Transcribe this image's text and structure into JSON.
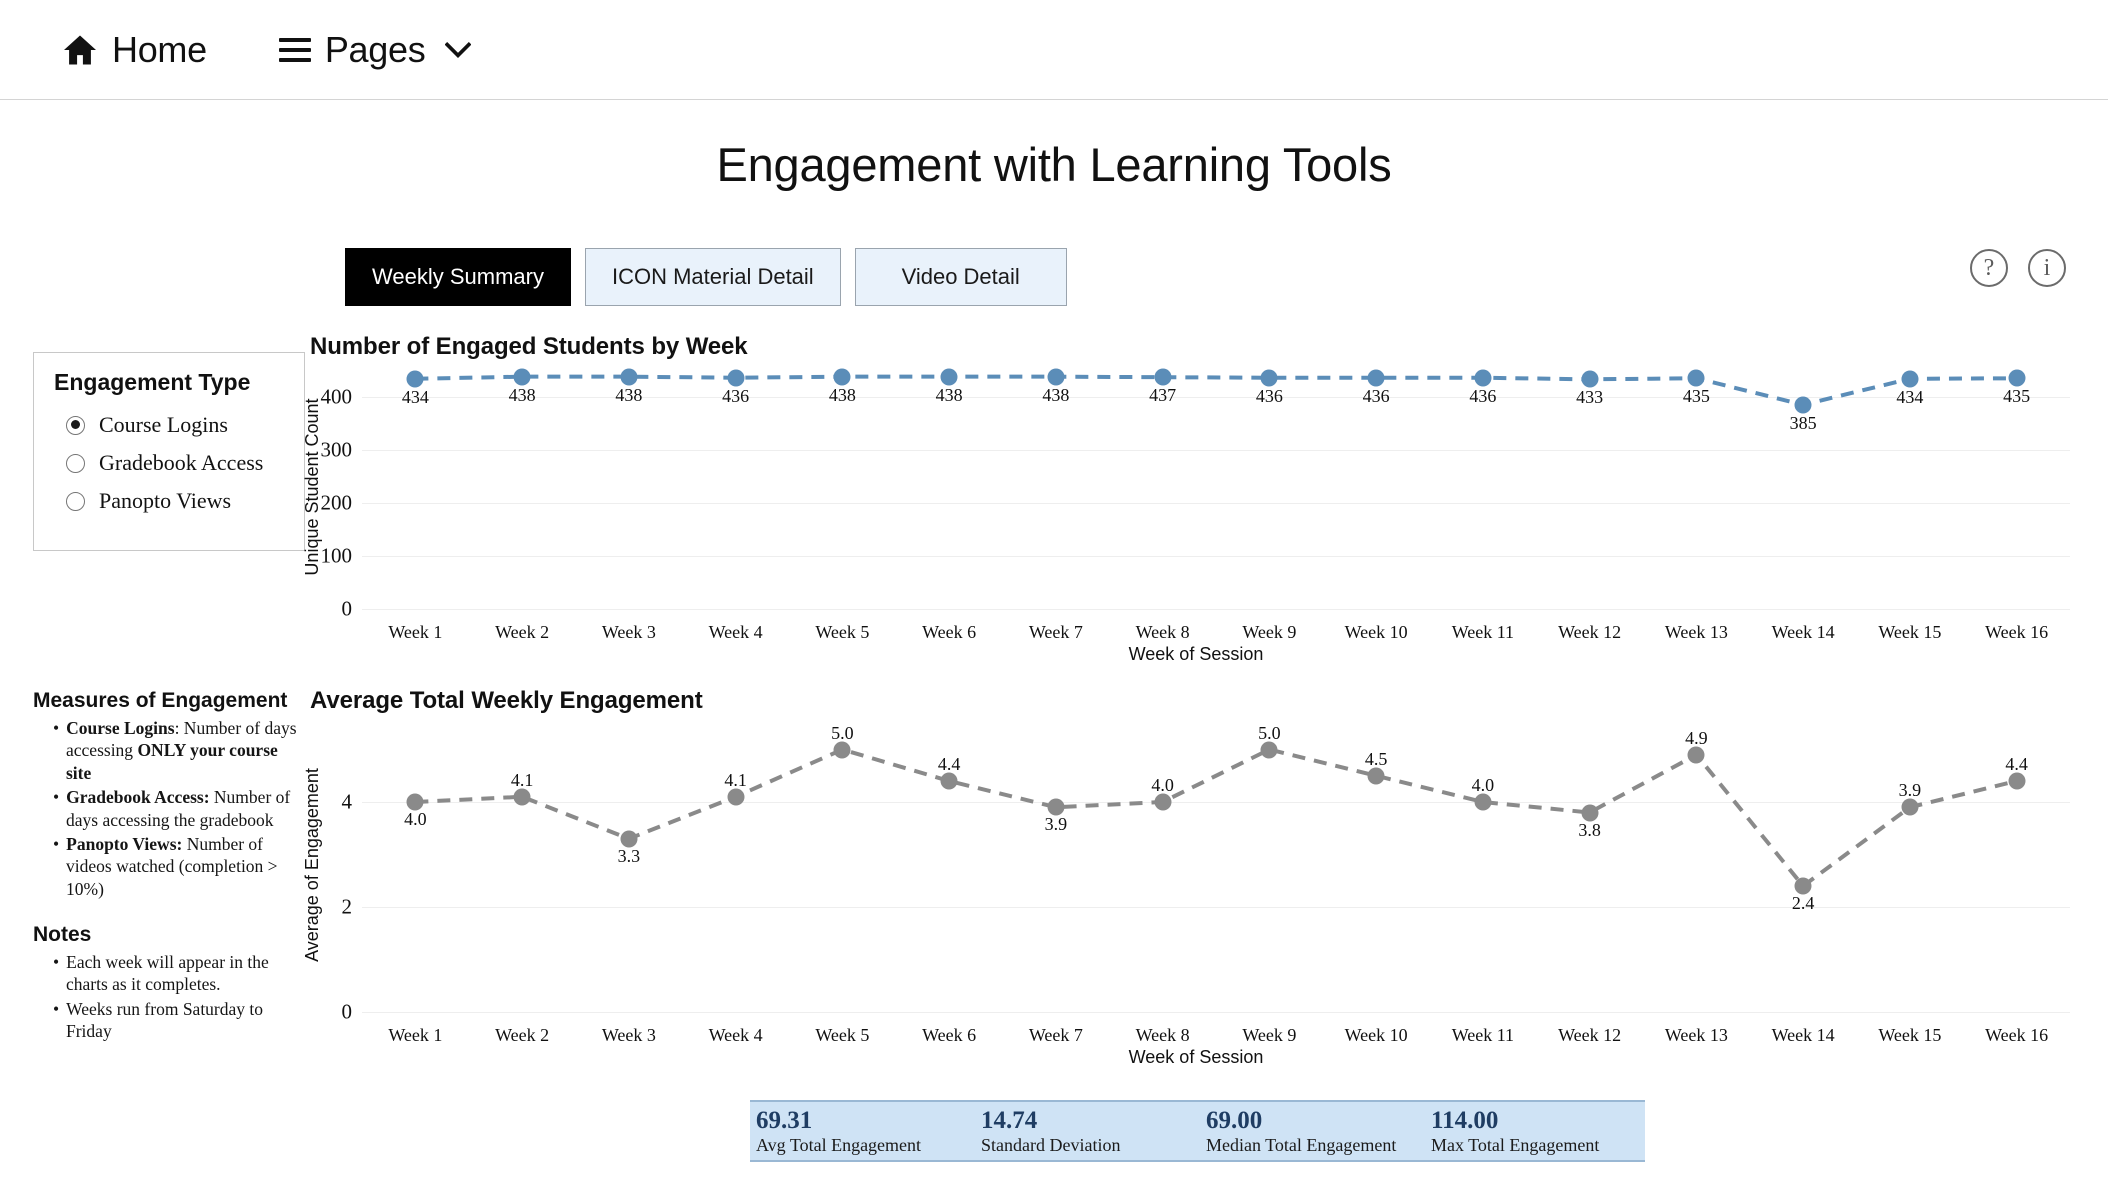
{
  "nav": {
    "home_label": "Home",
    "pages_label": "Pages",
    "home_icon": "home-icon",
    "menu_icon": "hamburger-icon",
    "chevron_icon": "chevron-down-icon"
  },
  "page_title": "Engagement with Learning Tools",
  "tabs": [
    {
      "label": "Weekly Summary",
      "active": true
    },
    {
      "label": "ICON Material Detail",
      "active": false
    },
    {
      "label": "Video Detail",
      "active": false
    }
  ],
  "top_icons": [
    {
      "name": "help-icon",
      "glyph": "?"
    },
    {
      "name": "info-icon",
      "glyph": "i"
    }
  ],
  "engagement_type": {
    "title": "Engagement Type",
    "options": [
      {
        "label": "Course Logins",
        "selected": true
      },
      {
        "label": "Gradebook Access",
        "selected": false
      },
      {
        "label": "Panopto Views",
        "selected": false
      }
    ]
  },
  "measures": {
    "title": "Measures of Engagement",
    "items": [
      {
        "term": "Course Logins",
        "sep": ": ",
        "text": "Number of days accessing ",
        "strong_tail": "ONLY your course site"
      },
      {
        "term": "Gradebook Access:",
        "sep": " ",
        "text": "Number of days accessing the gradebook",
        "strong_tail": ""
      },
      {
        "term": "Panopto Views:",
        "sep": " ",
        "text": "Number of videos watched (completion > 10%)",
        "strong_tail": ""
      }
    ]
  },
  "notes": {
    "title": "Notes",
    "items": [
      "Each week will appear in the charts as it completes.",
      "Weeks run from Saturday to Friday"
    ]
  },
  "chart_data": [
    {
      "type": "line",
      "title": "Number of Engaged Students by Week",
      "xlabel": "Week of Session",
      "ylabel": "Unique Student Count",
      "categories": [
        "Week 1",
        "Week 2",
        "Week 3",
        "Week 4",
        "Week 5",
        "Week 6",
        "Week 7",
        "Week 8",
        "Week 9",
        "Week 10",
        "Week 11",
        "Week 12",
        "Week 13",
        "Week 14",
        "Week 15",
        "Week 16"
      ],
      "values": [
        434,
        438,
        438,
        436,
        438,
        438,
        438,
        437,
        436,
        436,
        436,
        433,
        435,
        385,
        434,
        435
      ],
      "labels": [
        "434",
        "438",
        "438",
        "436",
        "438",
        "438",
        "438",
        "437",
        "436",
        "436",
        "436",
        "433",
        "435",
        "385",
        "434",
        "435"
      ],
      "ylim": [
        0,
        460
      ],
      "yticks": [
        0,
        100,
        200,
        300,
        400
      ],
      "ytick_labels": [
        "0",
        "100",
        "200",
        "300",
        "400"
      ],
      "grid": true,
      "color": "#5b8db8",
      "line_style": "dashed",
      "label_position": "below"
    },
    {
      "type": "line",
      "title": "Average Total Weekly Engagement",
      "xlabel": "Week of Session",
      "ylabel": "Average of Engagement",
      "categories": [
        "Week 1",
        "Week 2",
        "Week 3",
        "Week 4",
        "Week 5",
        "Week 6",
        "Week 7",
        "Week 8",
        "Week 9",
        "Week 10",
        "Week 11",
        "Week 12",
        "Week 13",
        "Week 14",
        "Week 15",
        "Week 16"
      ],
      "values": [
        4.0,
        4.1,
        3.3,
        4.1,
        5.0,
        4.4,
        3.9,
        4.0,
        5.0,
        4.5,
        4.0,
        3.8,
        4.9,
        2.4,
        3.9,
        4.4
      ],
      "labels": [
        "4.0",
        "4.1",
        "3.3",
        "4.1",
        "5.0",
        "4.4",
        "3.9",
        "4.0",
        "5.0",
        "4.5",
        "4.0",
        "3.8",
        "4.9",
        "2.4",
        "3.9",
        "4.4"
      ],
      "ylim": [
        0,
        5.6
      ],
      "yticks": [
        0,
        2,
        4
      ],
      "ytick_labels": [
        "0",
        "2",
        "4"
      ],
      "grid": true,
      "color": "#8a8a8a",
      "line_style": "dashed",
      "label_position": "mixed"
    }
  ],
  "stats": [
    {
      "value": "69.31",
      "label": "Avg Total Engagement"
    },
    {
      "value": "14.74",
      "label": "Standard Deviation"
    },
    {
      "value": "69.00",
      "label": "Median Total Engagement"
    },
    {
      "value": "114.00",
      "label": "Max Total Engagement"
    }
  ]
}
